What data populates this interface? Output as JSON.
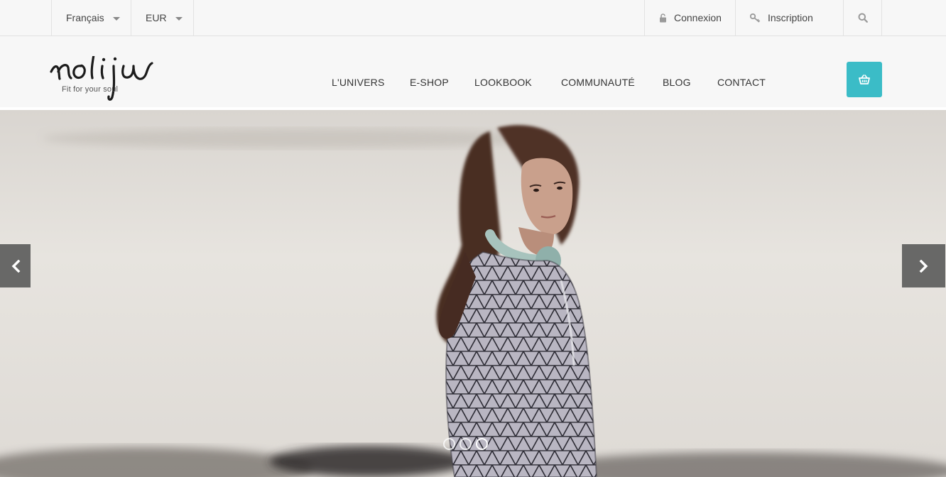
{
  "topbar": {
    "language": "Français",
    "currency": "EUR",
    "login": "Connexion",
    "register": "Inscription"
  },
  "brand": {
    "logo_text": "nolijn",
    "tagline": "Fit for your soul"
  },
  "nav": {
    "items": [
      {
        "label": "L'UNIVERS"
      },
      {
        "label": "E-SHOP"
      },
      {
        "label": "LOOKBOOK"
      },
      {
        "label": "COMMUNAUTÉ"
      },
      {
        "label": "BLOG"
      },
      {
        "label": "CONTACT"
      }
    ]
  },
  "icons": {
    "search": "search-icon",
    "lock": "lock-icon",
    "key": "key-icon",
    "cart": "basket-icon",
    "prev": "chevron-left-icon",
    "next": "chevron-right-icon"
  },
  "colors": {
    "accent": "#3bbcc7",
    "topbar_bg": "#f7f7f7",
    "text": "#444444"
  },
  "slider": {
    "slide_count": 3,
    "active_index": 2
  }
}
